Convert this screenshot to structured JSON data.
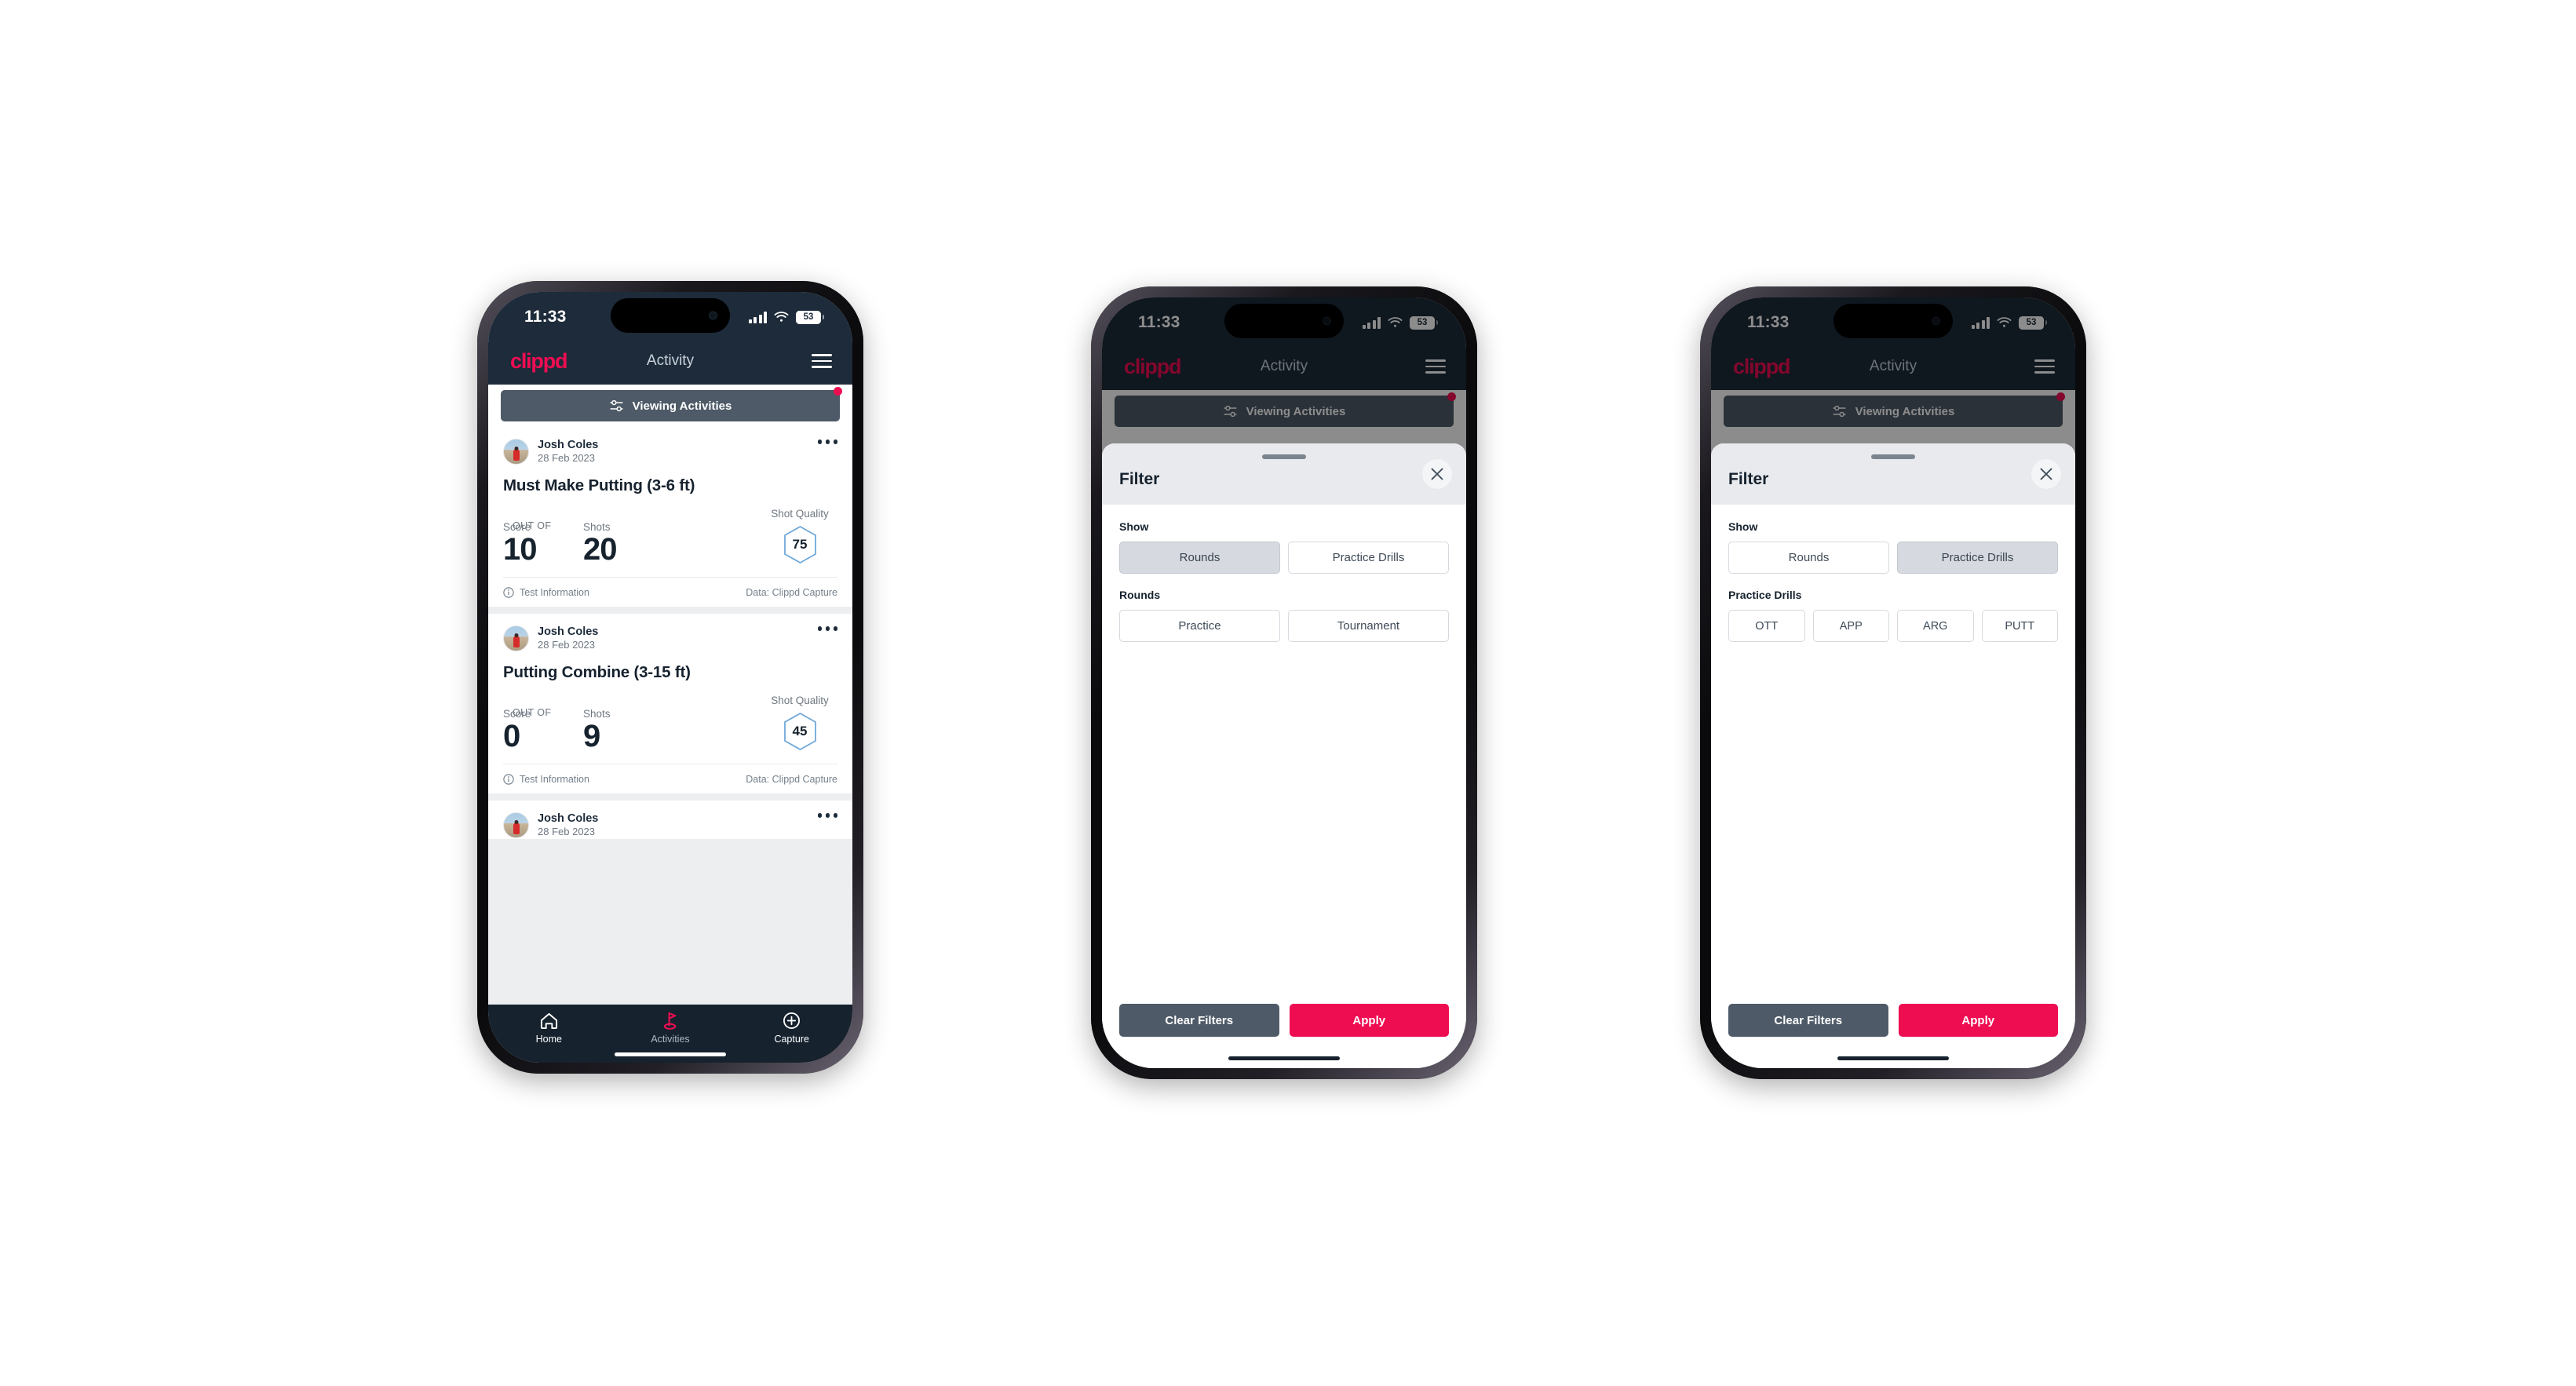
{
  "status_bar": {
    "time": "11:33",
    "battery": "53"
  },
  "app_header": {
    "logo": "clippd",
    "title": "Activity"
  },
  "filter_bar": {
    "label": "Viewing Activities"
  },
  "feed": {
    "cards": [
      {
        "user": "Josh Coles",
        "date": "28 Feb 2023",
        "title": "Must Make Putting (3-6 ft)",
        "score_label": "Score",
        "score_value": "10",
        "out_of": "OUT OF",
        "shots_label": "Shots",
        "shots_value": "20",
        "quality_label": "Shot Quality",
        "quality_value": "75",
        "footer_left": "Test Information",
        "footer_right": "Data: Clippd Capture"
      },
      {
        "user": "Josh Coles",
        "date": "28 Feb 2023",
        "title": "Putting Combine (3-15 ft)",
        "score_label": "Score",
        "score_value": "0",
        "out_of": "OUT OF",
        "shots_label": "Shots",
        "shots_value": "9",
        "quality_label": "Shot Quality",
        "quality_value": "45",
        "footer_left": "Test Information",
        "footer_right": "Data: Clippd Capture"
      },
      {
        "user": "Josh Coles",
        "date": "28 Feb 2023"
      }
    ]
  },
  "bottom_nav": {
    "items": [
      {
        "label": "Home",
        "icon": "home-icon",
        "active": false
      },
      {
        "label": "Activities",
        "icon": "golf-flag-icon",
        "active": true
      },
      {
        "label": "Capture",
        "icon": "plus-circle-icon",
        "active": false
      }
    ]
  },
  "filter_sheet_rounds": {
    "title": "Filter",
    "show_label": "Show",
    "show_options": [
      "Rounds",
      "Practice Drills"
    ],
    "show_selected": "Rounds",
    "group_label": "Rounds",
    "group_options": [
      "Practice",
      "Tournament"
    ],
    "clear_label": "Clear Filters",
    "apply_label": "Apply"
  },
  "filter_sheet_drills": {
    "title": "Filter",
    "show_label": "Show",
    "show_options": [
      "Rounds",
      "Practice Drills"
    ],
    "show_selected": "Practice Drills",
    "group_label": "Practice Drills",
    "group_options": [
      "OTT",
      "APP",
      "ARG",
      "PUTT"
    ],
    "clear_label": "Clear Filters",
    "apply_label": "Apply"
  },
  "colors": {
    "brand_pink": "#ef0d52",
    "header_navy": "#1d2b3a",
    "slate": "#4e5a67",
    "hex_blue": "#6fa8d8",
    "page_bg": "#ffffff"
  }
}
